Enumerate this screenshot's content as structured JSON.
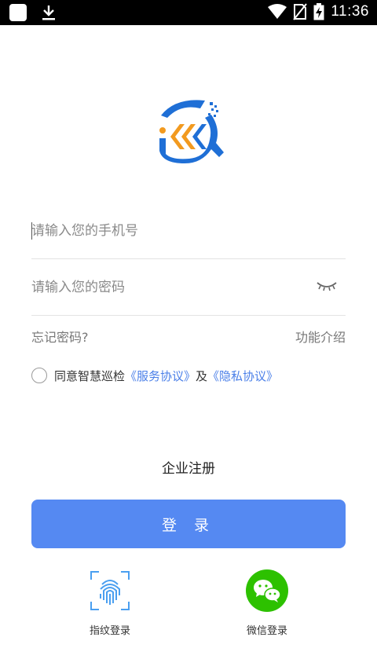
{
  "status_bar": {
    "time": "11:36"
  },
  "login": {
    "phone_placeholder": "请输入您的手机号",
    "password_placeholder": "请输入您的密码",
    "forgot_password": "忘记密码?",
    "features": "功能介绍",
    "agreement": {
      "prefix": "同意智慧巡检",
      "service": "《服务协议》",
      "and": "及",
      "privacy": "《隐私协议》"
    },
    "register": "企业注册",
    "login_button": "登 录",
    "fingerprint_label": "指纹登录",
    "wechat_label": "微信登录"
  },
  "colors": {
    "primary": "#5589f2",
    "link": "#4a7fe8",
    "wechat": "#2dc100",
    "logo_blue": "#1f6fd6",
    "logo_orange": "#f29a1f"
  },
  "icons": [
    "app-icon",
    "download-icon",
    "wifi-icon",
    "no-sim-icon",
    "battery-charging-icon",
    "eye-closed-icon",
    "fingerprint-icon",
    "wechat-icon"
  ]
}
